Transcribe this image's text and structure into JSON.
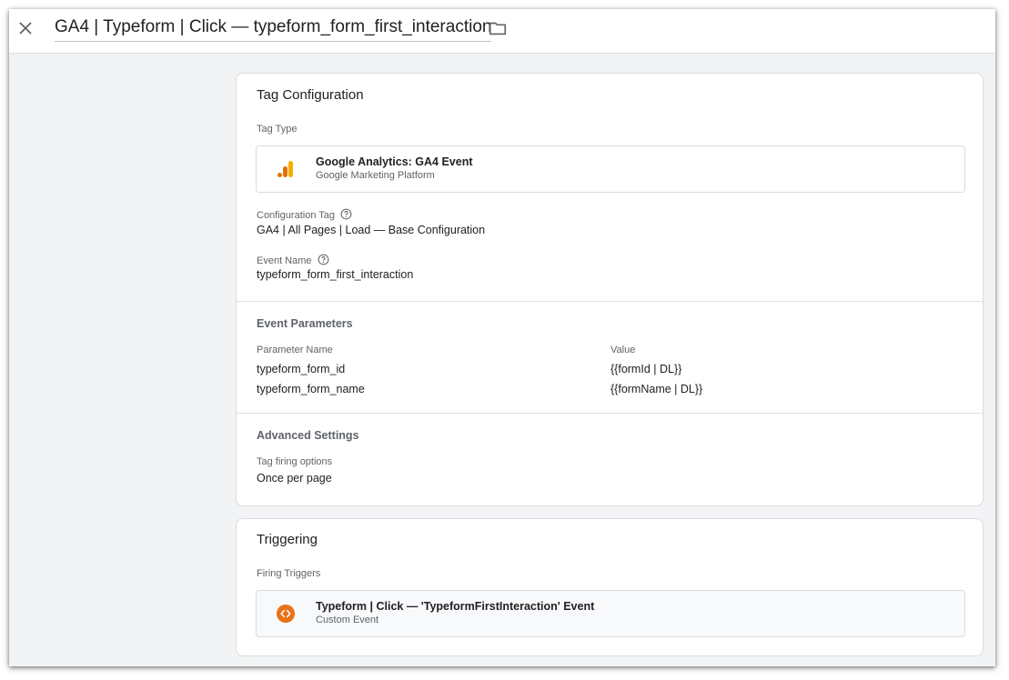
{
  "header": {
    "title": "GA4 | Typeform | Click — typeform_form_first_interaction",
    "close_icon": "close-icon",
    "folder_icon": "folder-icon"
  },
  "tag_config": {
    "title": "Tag Configuration",
    "tag_type_label": "Tag Type",
    "tag_type_name": "Google Analytics: GA4 Event",
    "tag_type_platform": "Google Marketing Platform",
    "tag_type_icon": "google-analytics-icon",
    "config_tag_label": "Configuration Tag",
    "config_tag_value": "GA4 | All Pages | Load — Base Configuration",
    "event_name_label": "Event Name",
    "event_name_value": "typeform_form_first_interaction",
    "event_params": {
      "title": "Event Parameters",
      "col_name": "Parameter Name",
      "col_value": "Value",
      "rows": [
        {
          "name": "typeform_form_id",
          "value": "{{formId | DL}}"
        },
        {
          "name": "typeform_form_name",
          "value": "{{formName | DL}}"
        }
      ]
    },
    "advanced": {
      "title": "Advanced Settings",
      "firing_options_label": "Tag firing options",
      "firing_options_value": "Once per page"
    }
  },
  "triggering": {
    "title": "Triggering",
    "firing_label": "Firing Triggers",
    "trigger_name": "Typeform | Click — 'TypeformFirstInteraction' Event",
    "trigger_type": "Custom Event",
    "trigger_icon": "custom-event-icon"
  },
  "colors": {
    "ga_orange_dark": "#E37400",
    "ga_orange_light": "#F9AB00",
    "custom_event_orange": "#E8711A",
    "background": "#F1F3F4"
  }
}
